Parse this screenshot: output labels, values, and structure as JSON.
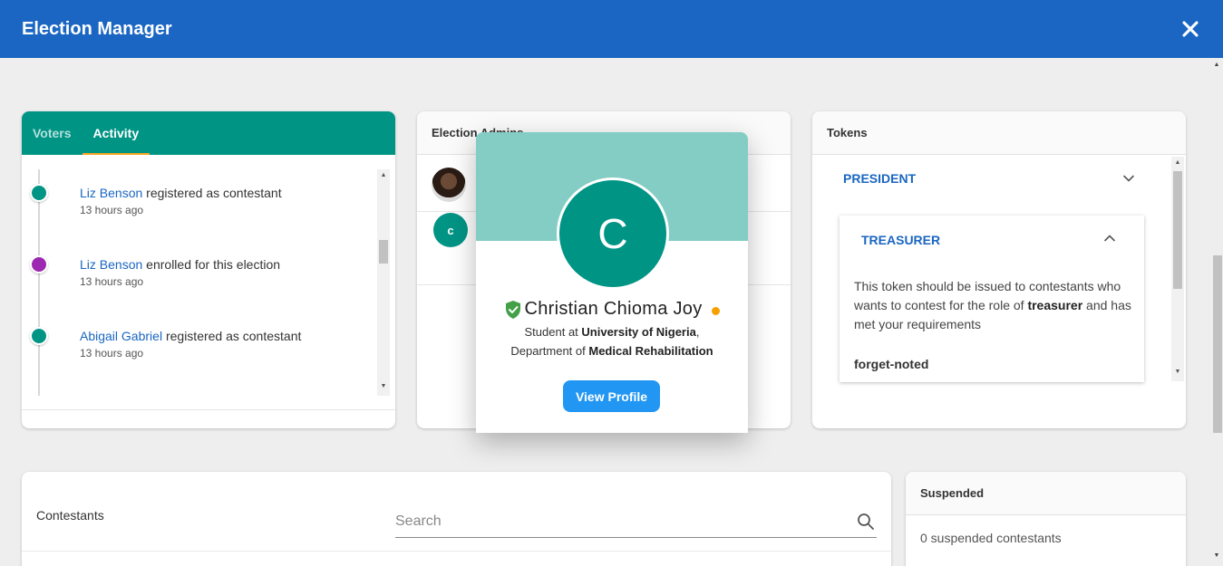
{
  "app": {
    "title": "Election Manager"
  },
  "activity": {
    "tabs": [
      {
        "label": "Voters"
      },
      {
        "label": "Activity"
      }
    ],
    "items": [
      {
        "name": "Liz Benson",
        "action": "registered as contestant",
        "time": "13 hours ago",
        "color": "#009485"
      },
      {
        "name": "Liz Benson",
        "action": "enrolled for this election",
        "time": "13 hours ago",
        "color": "#9c27b0"
      },
      {
        "name": "Abigail Gabriel",
        "action": "registered as contestant",
        "time": "13 hours ago",
        "color": "#009485"
      }
    ]
  },
  "admins": {
    "header": "Election Admins",
    "items": [
      {
        "avatar": "photo"
      },
      {
        "avatar_letter": "c"
      }
    ]
  },
  "profile_popup": {
    "avatar_letter": "C",
    "name": "Christian Chioma Joy",
    "verified_icon": "shield-check-icon",
    "line1_prefix": "Student at ",
    "institution": "University of Nigeria",
    "line1_suffix": ",",
    "line2_prefix": "Department of ",
    "department": "Medical Rehabilitation",
    "button": "View Profile",
    "status_color": "#f5a000"
  },
  "tokens": {
    "header": "Tokens",
    "items": [
      {
        "label": "PRESIDENT",
        "expanded": false
      },
      {
        "label": "TREASURER",
        "expanded": true,
        "desc_pre": "This token should be issued to contestants who wants to contest for the role of ",
        "desc_bold": "treasurer",
        "desc_post": " and has met your requirements",
        "code": "forget-noted"
      }
    ]
  },
  "contestants": {
    "label": "Contestants",
    "search_placeholder": "Search"
  },
  "suspended": {
    "header": "Suspended",
    "text": "0 suspended contestants"
  },
  "colors": {
    "appbar": "#1a66c2",
    "teal": "#009485",
    "accent_tab": "#f5a623",
    "button": "#2196f3"
  }
}
